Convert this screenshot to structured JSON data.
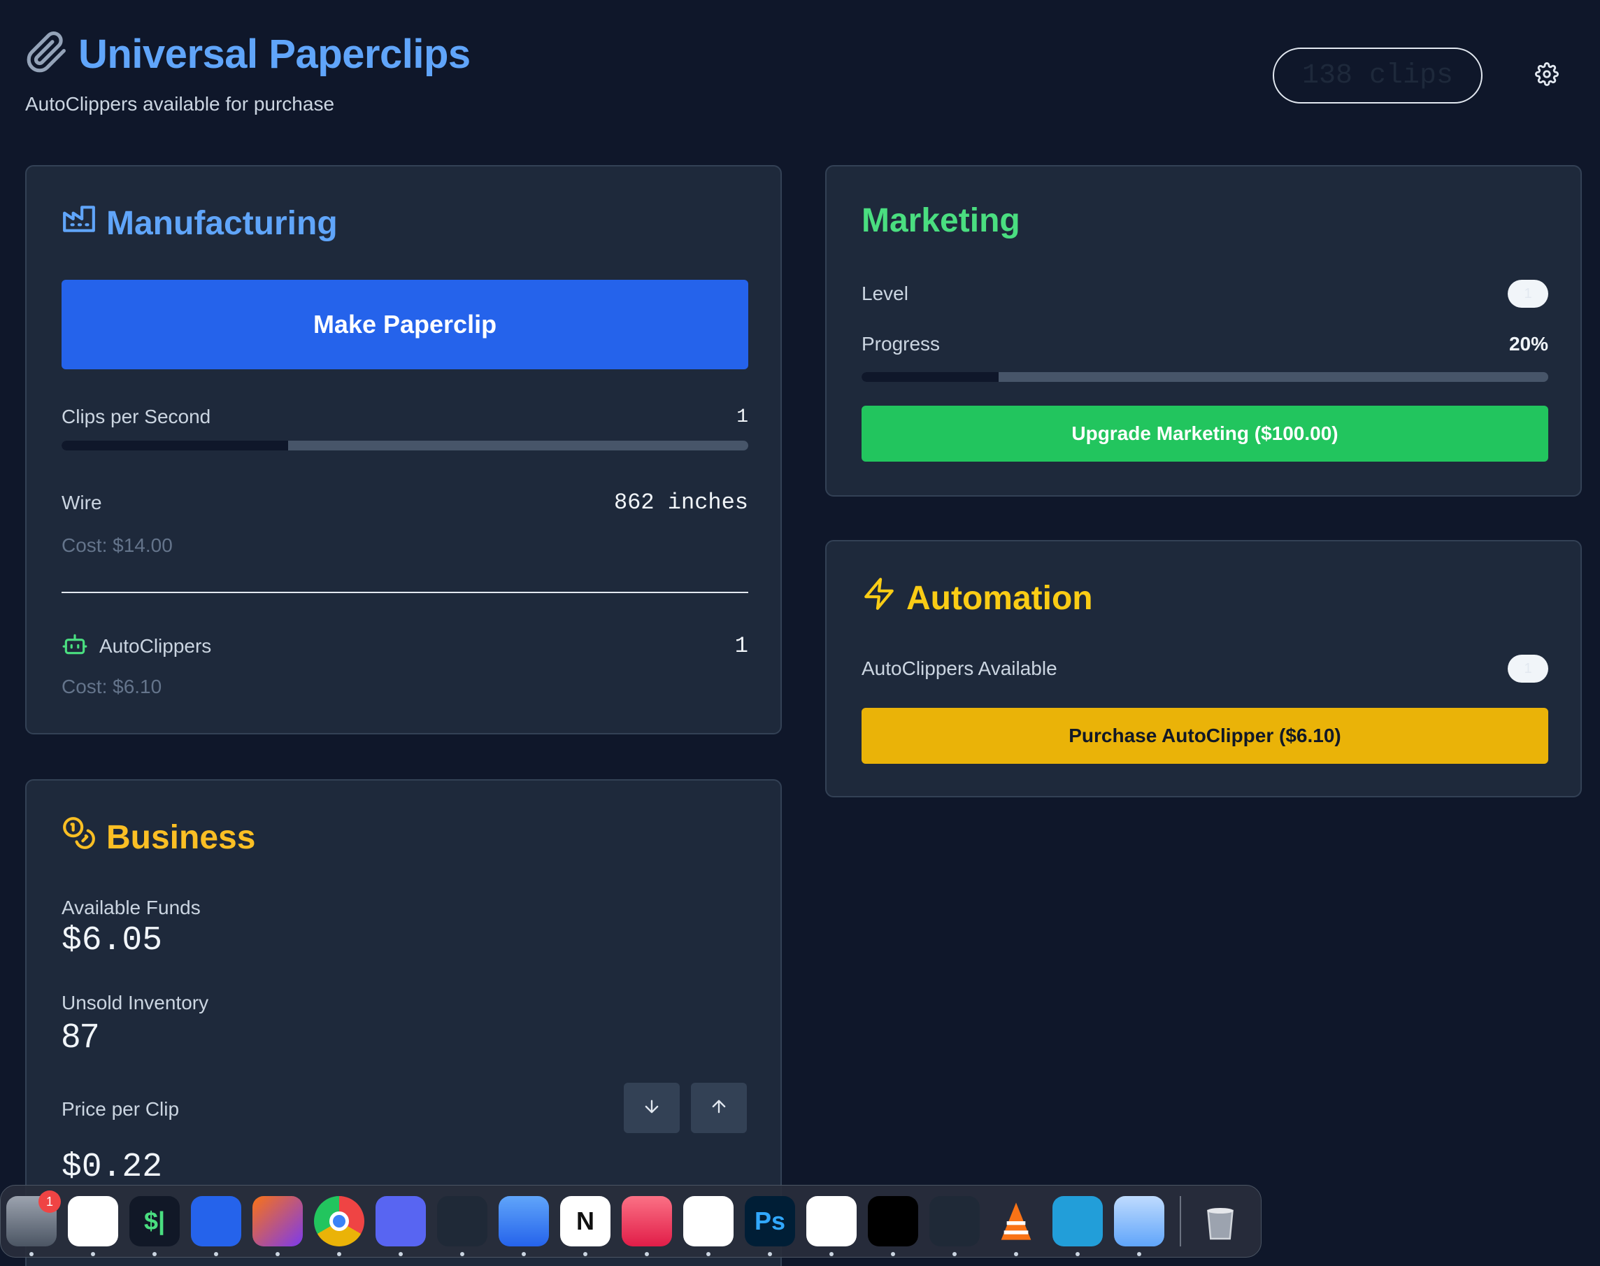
{
  "header": {
    "title": "Universal Paperclips",
    "subtitle": "AutoClippers available for purchase",
    "clips_counter": "138 clips"
  },
  "manufacturing": {
    "title": "Manufacturing",
    "make_button": "Make Paperclip",
    "clips_per_second_label": "Clips per Second",
    "clips_per_second_value": "1",
    "clips_per_second_bar_fraction": 0.33,
    "wire_label": "Wire",
    "wire_value": "862 inches",
    "wire_cost": "Cost: $14.00",
    "autoclippers_label": "AutoClippers",
    "autoclippers_value": "1",
    "autoclippers_cost": "Cost: $6.10"
  },
  "marketing": {
    "title": "Marketing",
    "level_label": "Level",
    "level_value": "1",
    "progress_label": "Progress",
    "progress_value": "20%",
    "progress_fraction": 0.2,
    "upgrade_button": "Upgrade Marketing ($100.00)"
  },
  "automation": {
    "title": "Automation",
    "available_label": "AutoClippers Available",
    "available_value": "1",
    "purchase_button": "Purchase AutoClipper ($6.10)"
  },
  "business": {
    "title": "Business",
    "funds_label": "Available Funds",
    "funds_value": "$6.05",
    "inventory_label": "Unsold Inventory",
    "inventory_value": "87",
    "price_label": "Price per Clip",
    "price_value": "$0.22"
  },
  "colors": {
    "background": "#0f172a",
    "card": "#1e293b",
    "blue_accent": "#60a5fa",
    "green_accent": "#4ade80",
    "yellow_accent": "#facc15",
    "make_button": "#2563eb",
    "upgrade_button": "#22c55e",
    "purchase_button": "#eab308"
  },
  "dock": {
    "items": [
      {
        "name": "system-settings-icon",
        "badge": "1"
      },
      {
        "name": "vscode-icon"
      },
      {
        "name": "terminal-icon",
        "glyph": "$|"
      },
      {
        "name": "notes-app-icon"
      },
      {
        "name": "firefox-icon"
      },
      {
        "name": "chrome-icon"
      },
      {
        "name": "discord-icon"
      },
      {
        "name": "obs-icon"
      },
      {
        "name": "mail-icon"
      },
      {
        "name": "notion-icon",
        "glyph": "N"
      },
      {
        "name": "music-icon"
      },
      {
        "name": "passwords-icon"
      },
      {
        "name": "photoshop-icon",
        "glyph": "Ps"
      },
      {
        "name": "chatgpt-icon"
      },
      {
        "name": "box-app-icon"
      },
      {
        "name": "activity-monitor-icon"
      },
      {
        "name": "vlc-icon"
      },
      {
        "name": "telegram-icon"
      },
      {
        "name": "preview-icon"
      },
      {
        "name": "trash-icon"
      }
    ]
  }
}
